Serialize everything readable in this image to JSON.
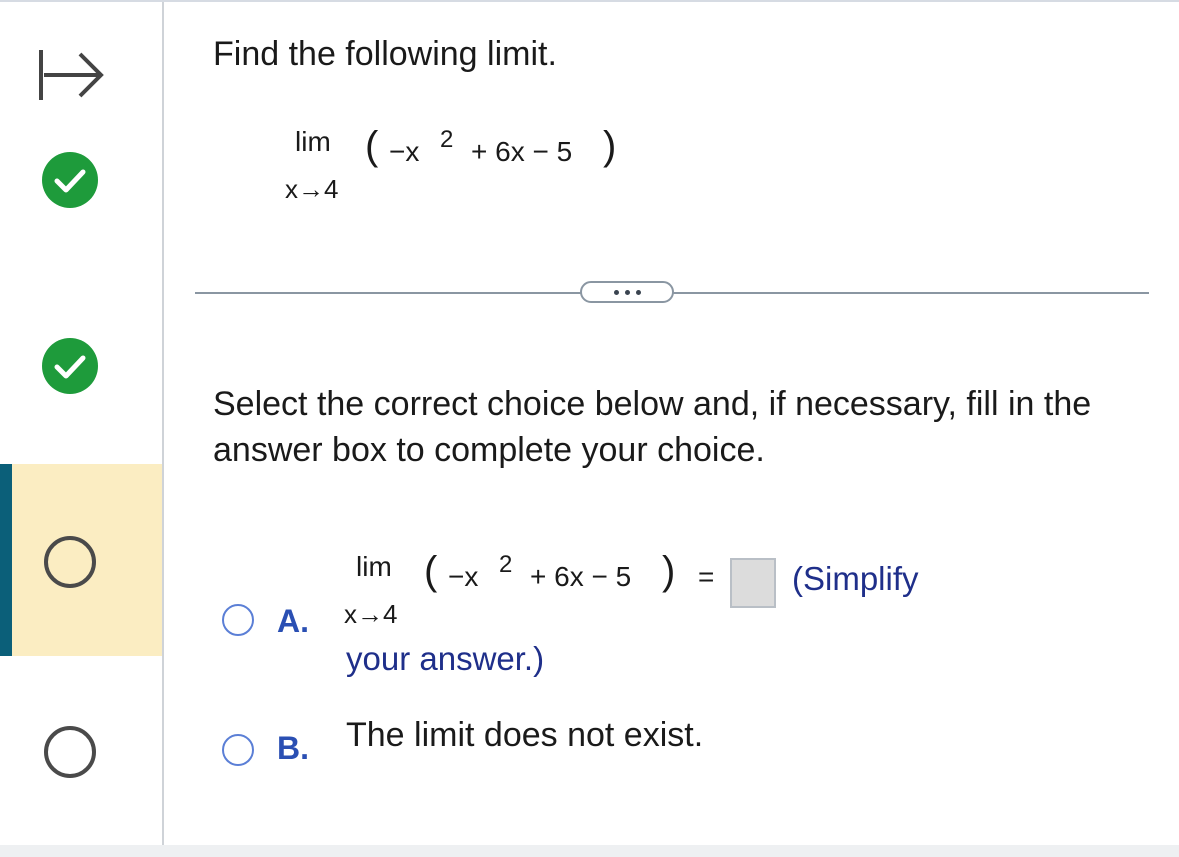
{
  "sidebar": {
    "expand_icon": "expand-right-arrow-icon",
    "items": [
      {
        "status": "correct",
        "icon": "check-circle-icon",
        "color": "#1e9b3b"
      },
      {
        "status": "correct",
        "icon": "check-circle-icon",
        "color": "#1e9b3b"
      },
      {
        "status": "current",
        "icon": "empty-circle-icon",
        "highlight": "#fbedc2",
        "accent": "#0b5f79"
      },
      {
        "status": "unanswered",
        "icon": "empty-circle-icon"
      }
    ]
  },
  "question": {
    "title": "Find the following limit.",
    "limit": {
      "lim": "lim",
      "approach": "x→4",
      "open_paren": "(",
      "expr_a": "−x",
      "exponent": "2",
      "expr_b": "+ 6x − 5",
      "close_paren": ")"
    }
  },
  "more_button": {
    "icon": "ellipsis-icon"
  },
  "instructions": "Select the correct choice below and, if necessary, fill in the answer box to complete your choice.",
  "choices": [
    {
      "letter": "A.",
      "limit": {
        "lim": "lim",
        "approach": "x→4",
        "open_paren": "(",
        "expr_a": "−x",
        "exponent": "2",
        "expr_b": "+ 6x − 5",
        "close_paren": ")",
        "equals": "="
      },
      "answer_value": "",
      "hint_line1": "(Simplify",
      "hint_line2": "your answer.)"
    },
    {
      "letter": "B.",
      "text": "The limit does not exist."
    }
  ],
  "colors": {
    "accent_blue": "#2a4fb3",
    "hint_navy": "#1f2f8a",
    "radio_border": "#5b7fd6",
    "check_green": "#1e9b3b"
  }
}
